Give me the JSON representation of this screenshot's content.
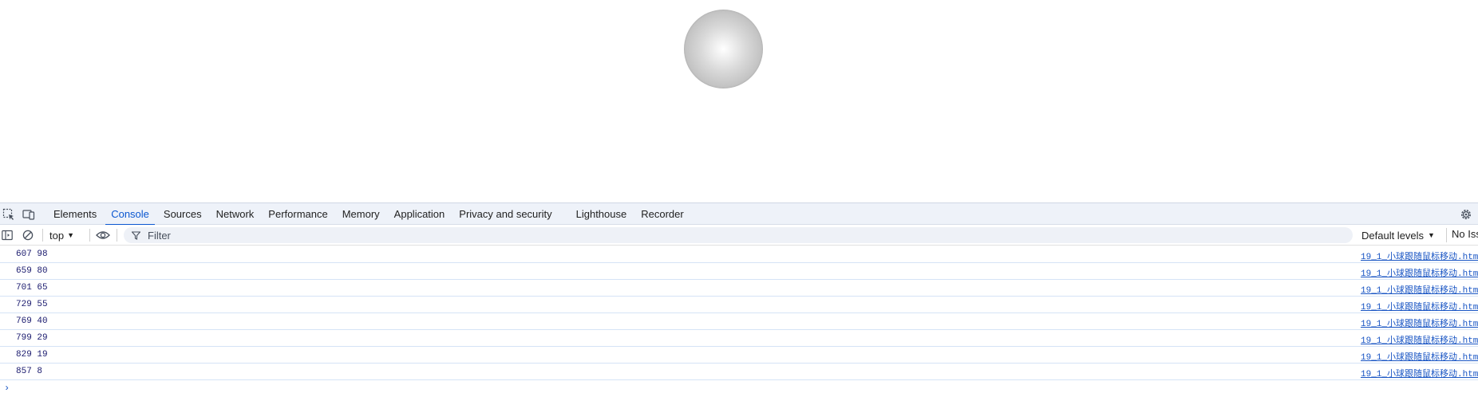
{
  "devtools": {
    "tabs": [
      {
        "label": "Elements"
      },
      {
        "label": "Console"
      },
      {
        "label": "Sources"
      },
      {
        "label": "Network"
      },
      {
        "label": "Performance"
      },
      {
        "label": "Memory"
      },
      {
        "label": "Application"
      },
      {
        "label": "Privacy and security"
      },
      {
        "label": "Lighthouse"
      },
      {
        "label": "Recorder"
      }
    ],
    "active_tab": "Console"
  },
  "console_toolbar": {
    "context": "top",
    "filter_placeholder": "Filter",
    "levels": "Default levels",
    "issues": "No Issu"
  },
  "console": {
    "messages": [
      {
        "text": "607 98",
        "source": "19_1_小球跟随鼠标移动.htm"
      },
      {
        "text": "659 80",
        "source": "19_1_小球跟随鼠标移动.htm"
      },
      {
        "text": "701 65",
        "source": "19_1_小球跟随鼠标移动.htm"
      },
      {
        "text": "729 55",
        "source": "19_1_小球跟随鼠标移动.htm"
      },
      {
        "text": "769 40",
        "source": "19_1_小球跟随鼠标移动.htm"
      },
      {
        "text": "799 29",
        "source": "19_1_小球跟随鼠标移动.htm"
      },
      {
        "text": "829 19",
        "source": "19_1_小球跟随鼠标移动.htm"
      },
      {
        "text": "857 8",
        "source": "19_1_小球跟随鼠标移动.htm"
      }
    ],
    "prompt": "›"
  },
  "colors": {
    "accent": "#0b57d0",
    "tabbar_bg": "#eef2f9",
    "link": "#1a56c4"
  }
}
